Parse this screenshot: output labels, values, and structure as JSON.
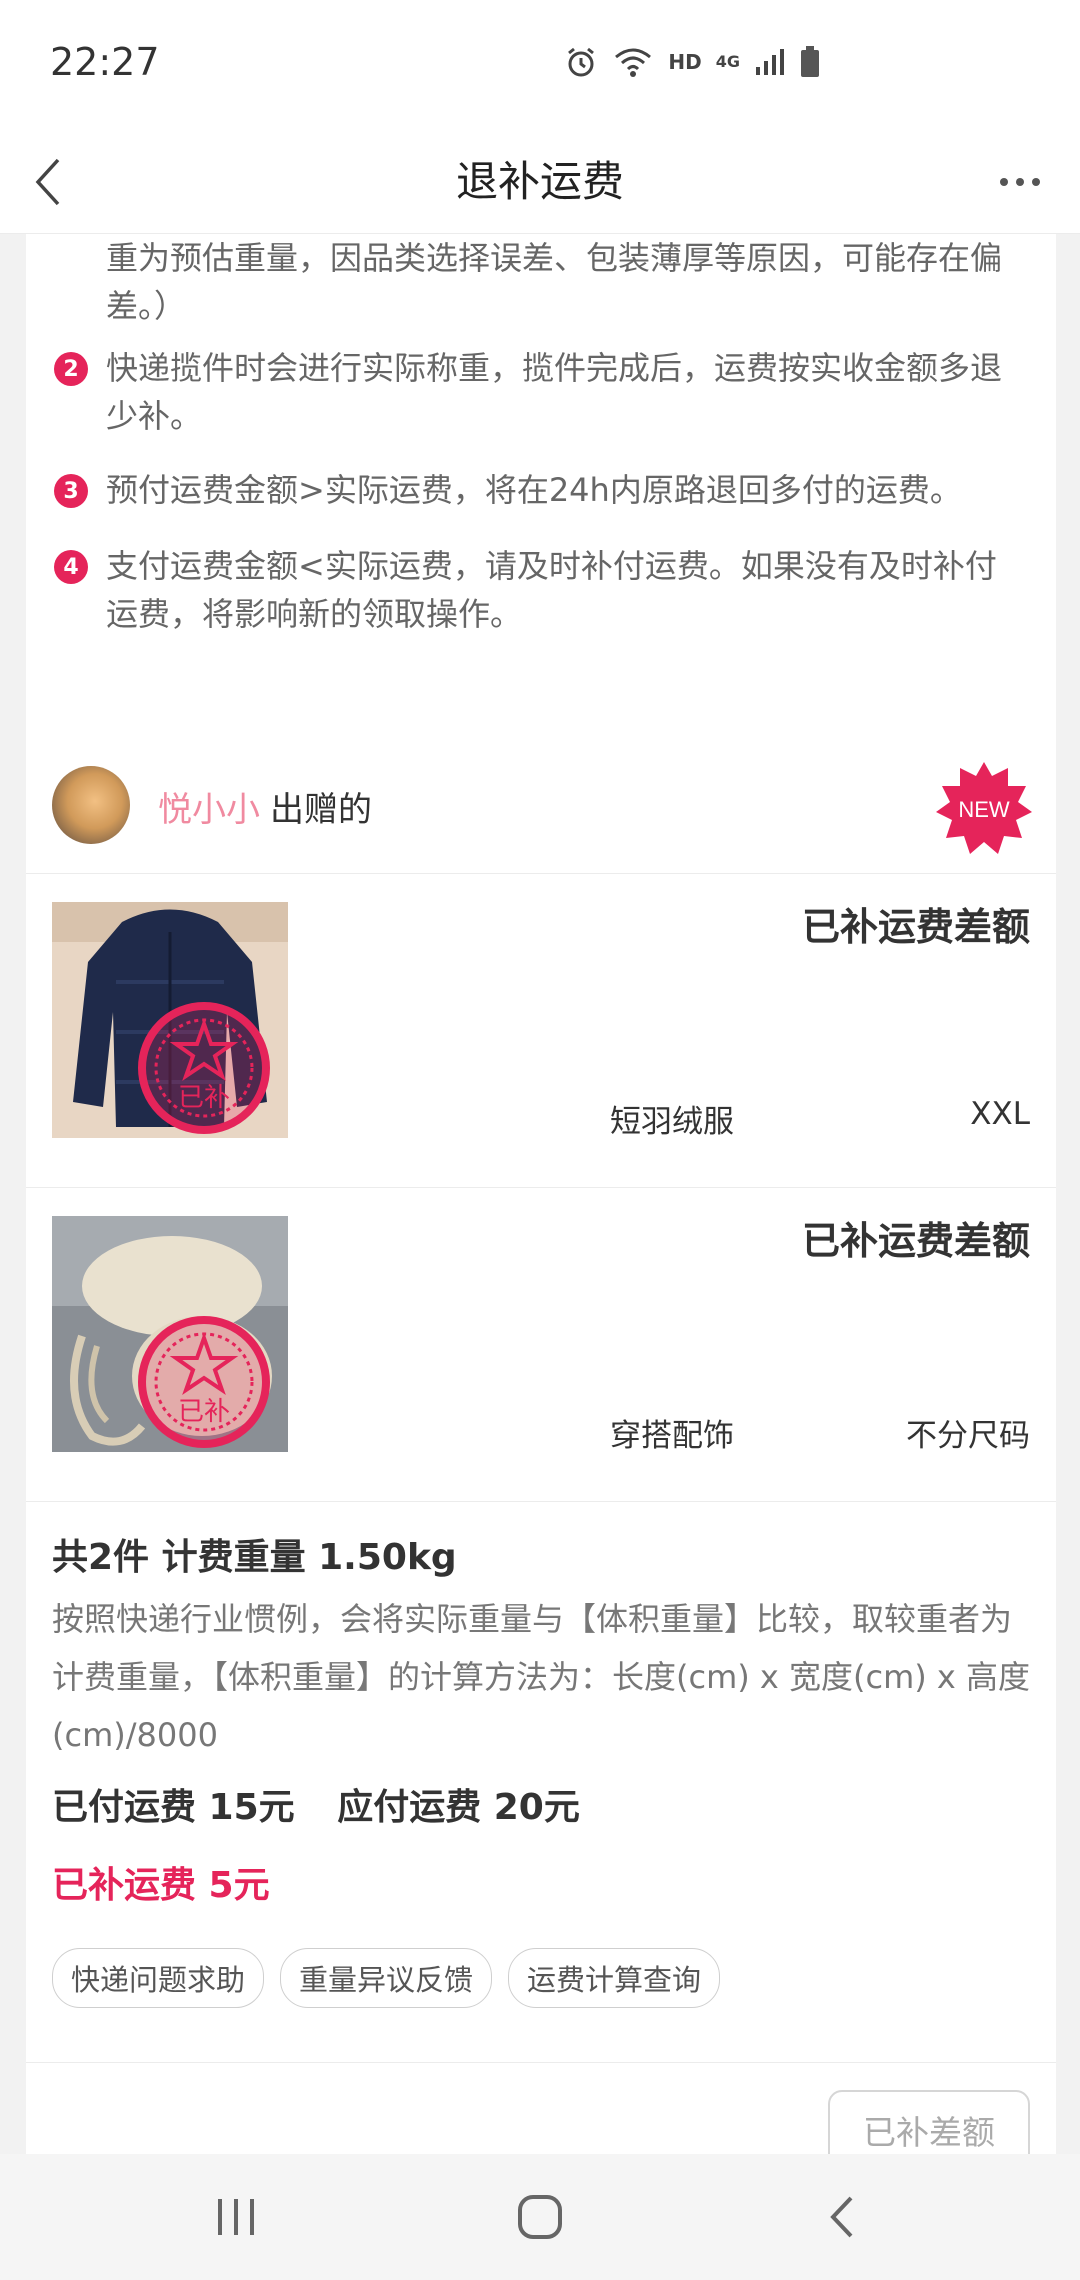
{
  "status_bar": {
    "time": "22:27",
    "hd": "HD",
    "network": "4G",
    "icons": [
      "alarm-icon",
      "wifi-icon",
      "signal-icon",
      "battery-icon"
    ]
  },
  "header": {
    "title": "退补运费",
    "back_icon": "chevron-left-icon",
    "more_icon": "more-icon"
  },
  "rules": {
    "partial_text": "重为预估重量，因品类选择误差、包装薄厚等原因，可能存在偏差。）",
    "items": [
      {
        "num": "2",
        "text": "快递揽件时会进行实际称重，揽件完成后，运费按实收金额多退少补。"
      },
      {
        "num": "3",
        "text": "预付运费金额>实际运费，将在24h内原路退回多付的运费。"
      },
      {
        "num": "4",
        "text": "支付运费金额<实际运费，请及时补付运费。如果没有及时补付运费，将影响新的领取操作。"
      }
    ]
  },
  "gift": {
    "giver_name": "悦小小",
    "giver_suffix": "出赠的",
    "new_badge": "NEW",
    "items": [
      {
        "status": "已补运费差额",
        "category": "短羽绒服",
        "size": "XXL",
        "stamp": "已补"
      },
      {
        "status": "已补运费差额",
        "category": "穿搭配饰",
        "size": "不分尺码",
        "stamp": "已补"
      }
    ],
    "summary": {
      "title": "共2件  计费重量 1.50kg",
      "description": "按照快递行业惯例，会将实际重量与【体积重量】比较，取较重者为计费重量，【体积重量】的计算方法为：长度(cm) x 宽度(cm) x 高度(cm)/8000",
      "paid": "已付运费 15元",
      "due": "应付运费 20元",
      "extra_paid": "已补运费 5元"
    },
    "tags": [
      "快递问题求助",
      "重量异议反馈",
      "运费计算查询"
    ],
    "action_button": "已补差额"
  },
  "colors": {
    "accent": "#e5245a",
    "giver_name": "#f08aa0"
  }
}
